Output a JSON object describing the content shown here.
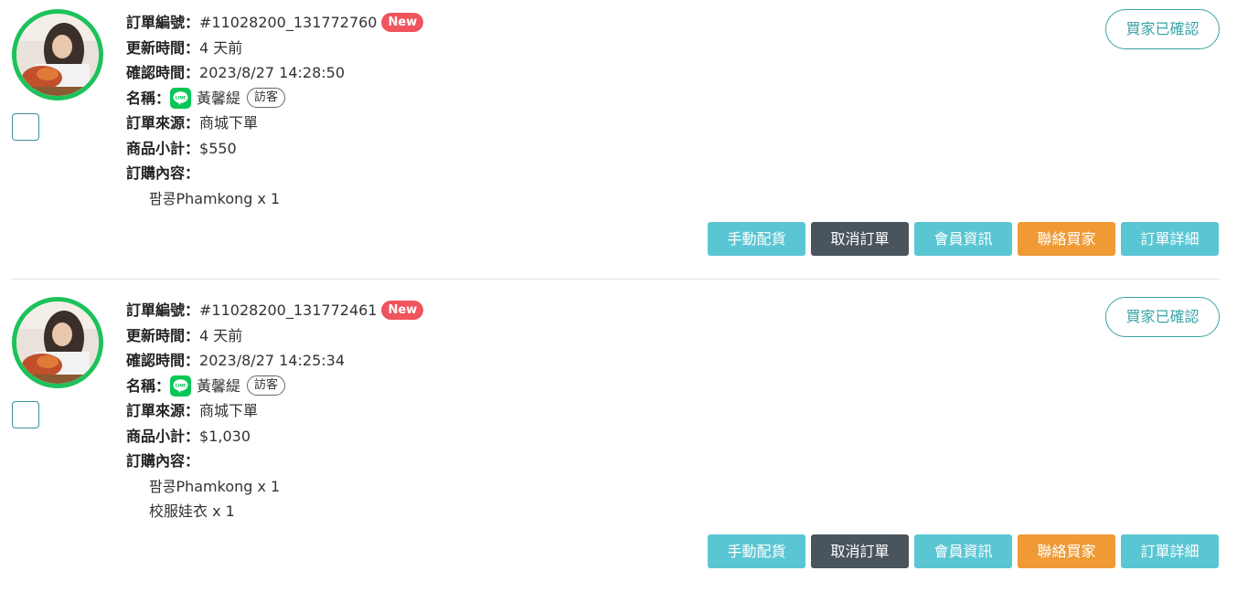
{
  "colors": {
    "accent": "#5bc6d3",
    "dark": "#4a545c",
    "orange": "#ef9a35",
    "new_badge": "#f0545c",
    "line_green": "#06c755"
  },
  "labels": {
    "order_no": "訂單編號：",
    "updated": "更新時間：",
    "confirmed": "確認時間：",
    "name": "名稱：",
    "source": "訂單來源：",
    "subtotal": "商品小計：",
    "content": "訂購內容："
  },
  "orders": [
    {
      "order_no": "#11028200_131772760",
      "new_badge": "New",
      "updated": "4 天前",
      "confirmed": "2023/8/27 14:28:50",
      "customer_name": "黃馨緹",
      "guest_badge": "訪客",
      "source": "商城下單",
      "subtotal": "$550",
      "items": [
        "팜콩Phamkong x 1"
      ],
      "status": "買家已確認",
      "buttons": [
        "手動配貨",
        "取消訂單",
        "會員資訊",
        "聯絡買家",
        "訂單詳細"
      ]
    },
    {
      "order_no": "#11028200_131772461",
      "new_badge": "New",
      "updated": "4 天前",
      "confirmed": "2023/8/27 14:25:34",
      "customer_name": "黃馨緹",
      "guest_badge": "訪客",
      "source": "商城下單",
      "subtotal": "$1,030",
      "items": [
        "팜콩Phamkong x 1",
        "校服娃衣 x 1"
      ],
      "status": "買家已確認",
      "buttons": [
        "手動配貨",
        "取消訂單",
        "會員資訊",
        "聯絡買家",
        "訂單詳細"
      ]
    }
  ]
}
